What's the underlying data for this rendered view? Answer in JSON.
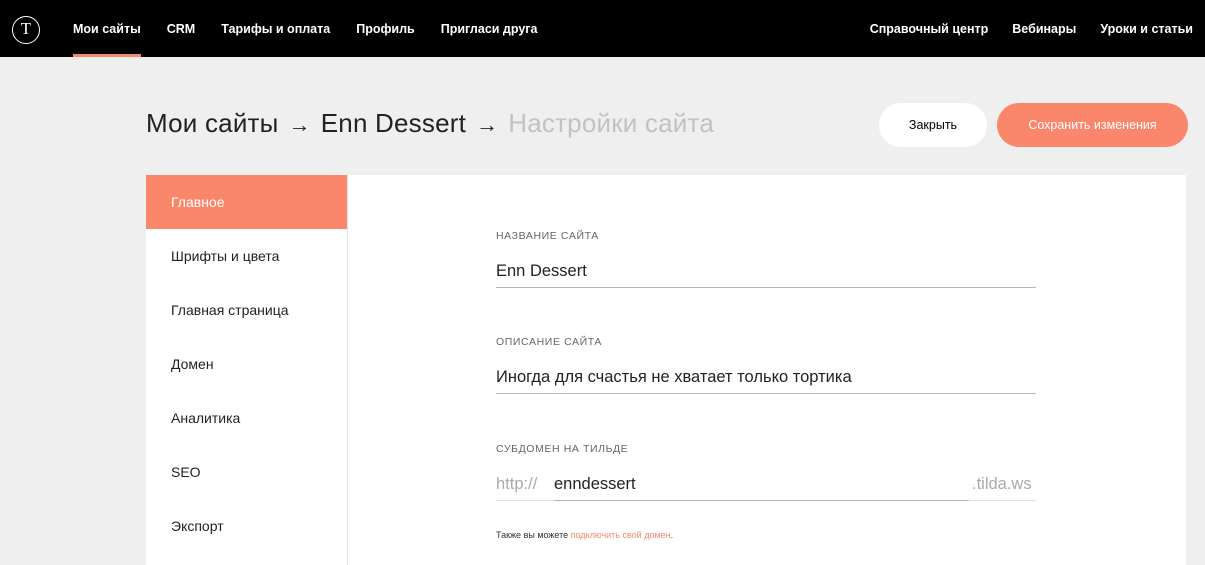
{
  "topnav": {
    "logo": "T",
    "left": [
      "Мои сайты",
      "CRM",
      "Тарифы и оплата",
      "Профиль",
      "Пригласи друга"
    ],
    "right": [
      "Справочный центр",
      "Вебинары",
      "Уроки и статьи"
    ],
    "active": "Мои сайты"
  },
  "breadcrumb": {
    "root": "Мои сайты",
    "site": "Enn Dessert",
    "current": "Настройки сайта",
    "separator": "→"
  },
  "actions": {
    "close_label": "Закрыть",
    "save_label": "Сохранить изменения"
  },
  "sidebar": {
    "items": [
      "Главное",
      "Шрифты и цвета",
      "Главная страница",
      "Домен",
      "Аналитика",
      "SEO",
      "Экспорт"
    ],
    "active": "Главное"
  },
  "form": {
    "site_name": {
      "label": "НАЗВАНИЕ САЙТА",
      "value": "Enn Dessert"
    },
    "site_description": {
      "label": "ОПИСАНИЕ САЙТА",
      "value": "Иногда для счастья не хватает только тортика"
    },
    "subdomain": {
      "label": "СУБДОМЕН НА ТИЛЬДЕ",
      "prefix": "http://",
      "value": "enndessert",
      "suffix": ".tilda.ws"
    },
    "hint_text": "Также вы можете ",
    "hint_link": "подключить свой домен",
    "hint_end": "."
  },
  "colors": {
    "accent": "#fa876b",
    "topbar": "#000000",
    "background": "#efefef"
  }
}
